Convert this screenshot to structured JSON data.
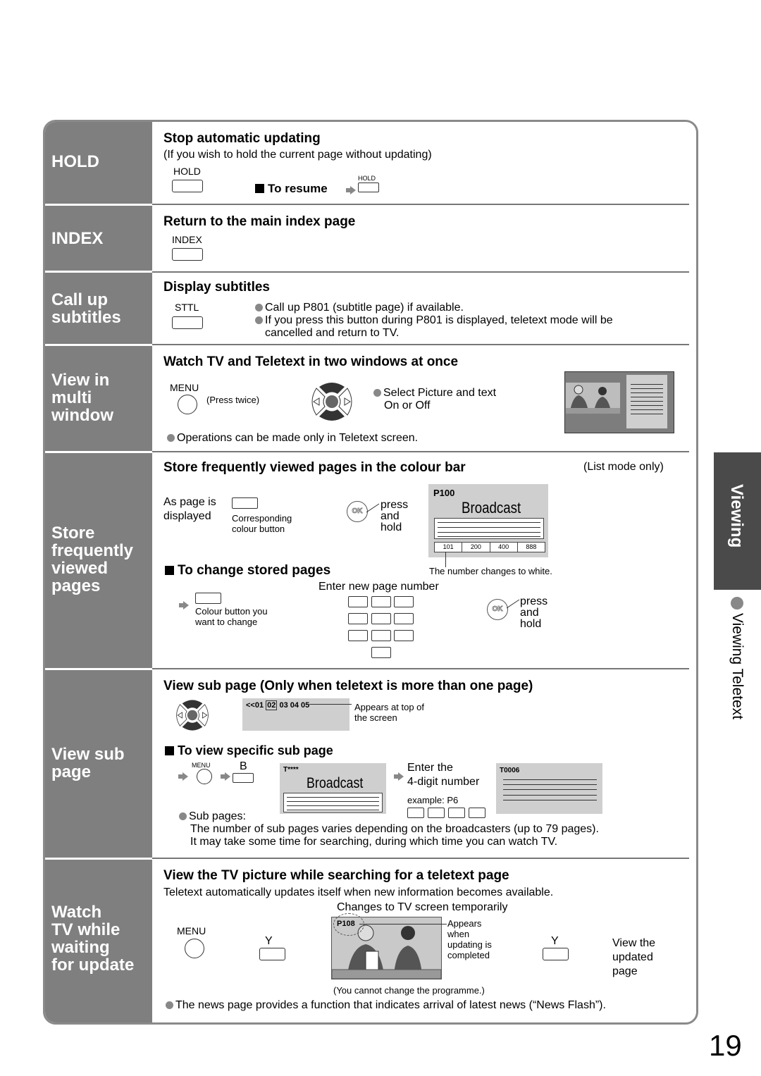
{
  "page_number": "19",
  "side_tab": {
    "section": "Viewing",
    "subsection": "Viewing Teletext"
  },
  "rows": [
    {
      "label": "HOLD",
      "heading": "Stop automatic updating",
      "note": "(If you wish to hold the current page without updating)",
      "button_label": "HOLD",
      "resume_label": "To resume",
      "resume_button_label": "HOLD"
    },
    {
      "label": "INDEX",
      "heading": "Return to the main index page",
      "button_label": "INDEX"
    },
    {
      "label_lines": [
        "Call up",
        "subtitles"
      ],
      "heading": "Display subtitles",
      "button_label": "STTL",
      "bullets": [
        "Call up P801 (subtitle page) if available.",
        "If you press this button during P801 is displayed, teletext mode will be",
        "cancelled and return to TV."
      ]
    },
    {
      "label_lines": [
        "View in",
        "multi",
        "window"
      ],
      "heading": "Watch TV and Teletext in two windows at once",
      "menu_label": "MENU",
      "press_note": "(Press twice)",
      "select_lines": [
        "Select Picture and text",
        "On or Off"
      ],
      "ok_glyph": "OK",
      "footnote": "Operations can be made only in Teletext screen."
    },
    {
      "label_lines": [
        "Store",
        "frequently",
        "viewed",
        "pages"
      ],
      "heading": "Store frequently viewed pages in the colour bar",
      "mode_note": "(List mode only)",
      "as_page_lines": [
        "As page is",
        "displayed"
      ],
      "corresponding_lines": [
        "Corresponding",
        "colour button"
      ],
      "ok_glyph": "OK",
      "press_hold": [
        "press",
        "and",
        "hold"
      ],
      "screen": {
        "page": "P100",
        "title": "Broadcast",
        "stored_pages": [
          "101",
          "200",
          "400",
          "888"
        ]
      },
      "number_note": "The number changes to white.",
      "change_heading": "To change stored pages",
      "enter_note": "Enter new page number",
      "colour_button_lines": [
        "Colour button you",
        "want to change"
      ]
    },
    {
      "label_lines": [
        "View sub",
        "page"
      ],
      "heading": "View sub page (Only when teletext is more than one page)",
      "subpage_bar": {
        "prefix": "<<01",
        "current": "02",
        "rest": "03 04 05"
      },
      "appears_lines": [
        "Appears at top of",
        "the screen"
      ],
      "specific_heading": "To view specific sub page",
      "menu_label": "MENU",
      "b_label": "B",
      "screen1": {
        "page": "T****",
        "title": "Broadcast"
      },
      "enter_lines": [
        "Enter the",
        "4-digit number"
      ],
      "example": "example: P6",
      "screen2": {
        "page": "T0006"
      },
      "sub_pages_label": "Sub pages:",
      "sub_pages_lines": [
        "The number of sub pages varies depending on the broadcasters (up to 79 pages).",
        "It may take some time for searching, during which time you can watch TV."
      ]
    },
    {
      "label_lines": [
        "Watch",
        "TV while",
        "waiting",
        "for update"
      ],
      "heading": "View the TV picture while searching for a teletext page",
      "intro": "Teletext automatically updates itself when new information becomes available.",
      "changes_note": "Changes to TV screen temporarily",
      "menu_label": "MENU",
      "y_label": "Y",
      "screen_page": "P108",
      "appears_lines": [
        "Appears",
        "when",
        "updating is",
        "completed"
      ],
      "y_label_2": "Y",
      "view_lines": [
        "View the",
        "updated",
        "page"
      ],
      "cannot_note": "(You cannot change the programme.)",
      "footnote": "The news page provides a function that indicates arrival of latest news (“News Flash”)."
    }
  ]
}
